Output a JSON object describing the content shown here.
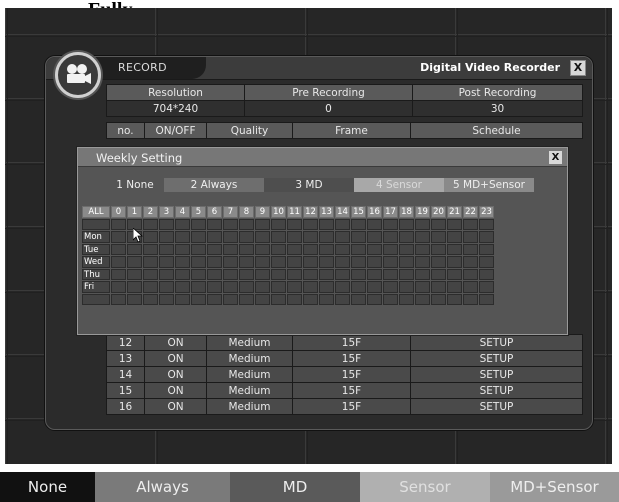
{
  "page_title": "Fully",
  "window": {
    "title": "RECORD",
    "app_title": "Digital Video Recorder",
    "close": "X"
  },
  "top_table": {
    "headers": [
      "Resolution",
      "Pre Recording",
      "Post Recording"
    ],
    "values": [
      "704*240",
      "0",
      "30"
    ]
  },
  "channel_headers": [
    "no.",
    "ON/OFF",
    "Quality",
    "Frame",
    "Schedule"
  ],
  "channel_rows": [
    {
      "no": "12",
      "onoff": "ON",
      "quality": "Medium",
      "frame": "15F",
      "schedule": "SETUP"
    },
    {
      "no": "13",
      "onoff": "ON",
      "quality": "Medium",
      "frame": "15F",
      "schedule": "SETUP"
    },
    {
      "no": "14",
      "onoff": "ON",
      "quality": "Medium",
      "frame": "15F",
      "schedule": "SETUP"
    },
    {
      "no": "15",
      "onoff": "ON",
      "quality": "Medium",
      "frame": "15F",
      "schedule": "SETUP"
    },
    {
      "no": "16",
      "onoff": "ON",
      "quality": "Medium",
      "frame": "15F",
      "schedule": "SETUP"
    }
  ],
  "weekly": {
    "title": "Weekly Setting",
    "close": "X",
    "modes": [
      "1 None",
      "2 Always",
      "3 MD",
      "4 Sensor",
      "5 MD+Sensor"
    ],
    "all_label": "ALL",
    "hours": [
      "0",
      "1",
      "2",
      "3",
      "4",
      "5",
      "6",
      "7",
      "8",
      "9",
      "10",
      "11",
      "12",
      "13",
      "14",
      "15",
      "16",
      "17",
      "18",
      "19",
      "20",
      "21",
      "22",
      "23"
    ],
    "days": [
      "",
      "Mon",
      "Tue",
      "Wed",
      "Thu",
      "Fri",
      ""
    ]
  },
  "legend": [
    "None",
    "Always",
    "MD",
    "Sensor",
    "MD+Sensor"
  ],
  "colors": {
    "none": "#111111",
    "always": "#6e6e6e",
    "md": "#4e4e4e",
    "sensor": "#a8a8a8",
    "md_sensor": "#8a8a8a"
  }
}
